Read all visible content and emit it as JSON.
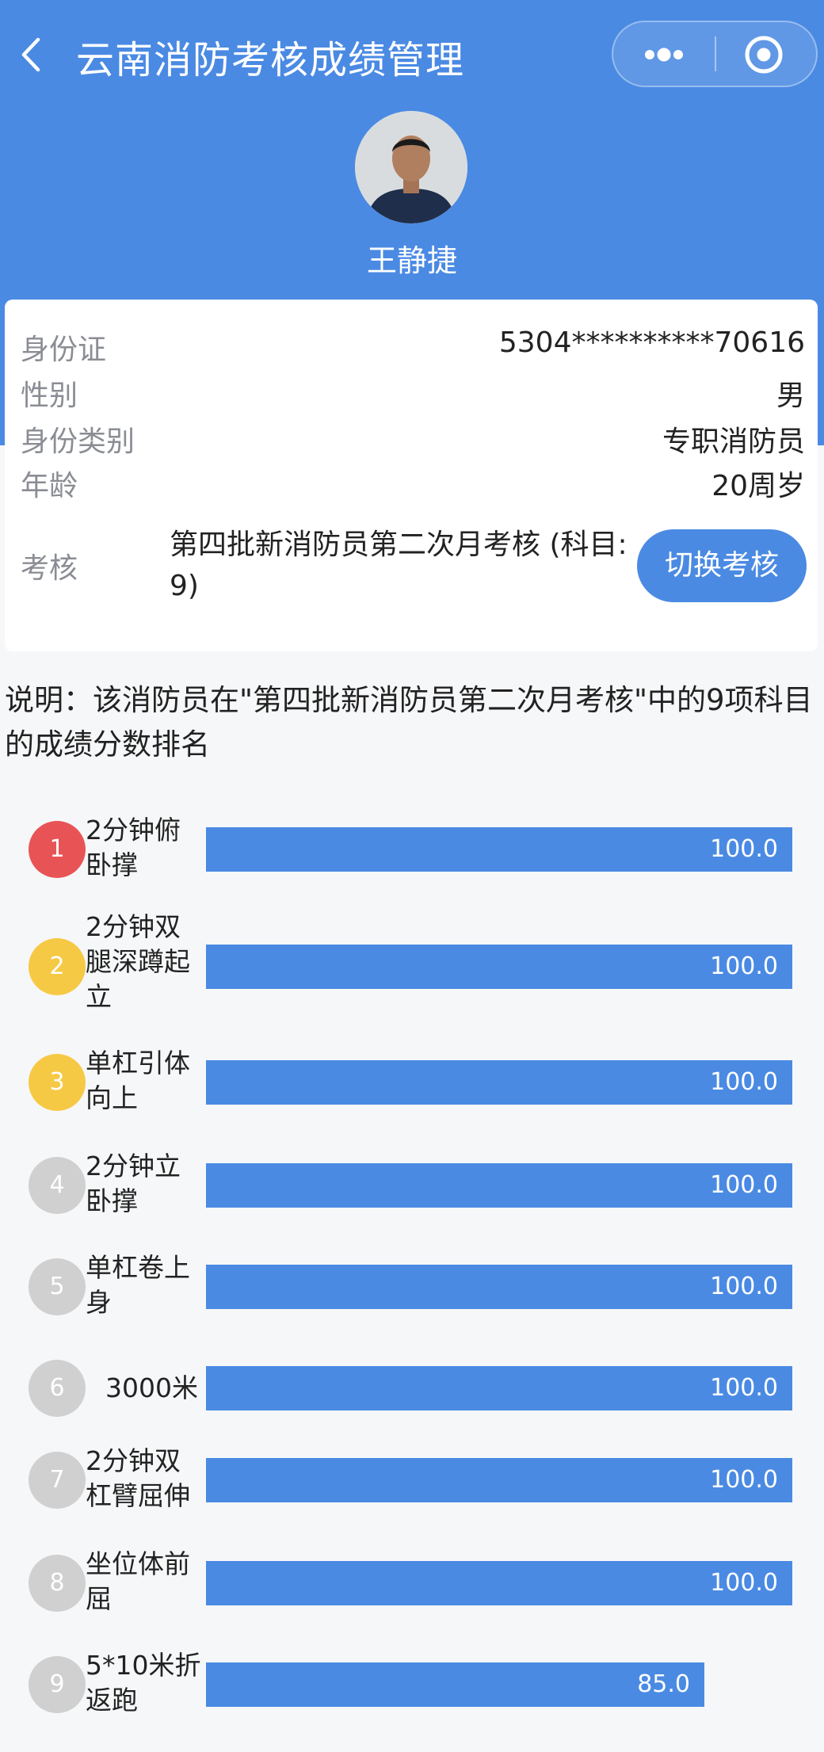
{
  "nav": {
    "title": "云南消防考核成绩管理",
    "back_icon": "chevron-left-icon",
    "more_icon": "more-dots-icon",
    "close_icon": "target-circle-icon"
  },
  "profile": {
    "name": "王静捷"
  },
  "info": [
    {
      "label": "身份证",
      "value": "5304**********70616"
    },
    {
      "label": "性别",
      "value": "男"
    },
    {
      "label": "身份类别",
      "value": "专职消防员"
    },
    {
      "label": "年龄",
      "value": "20周岁"
    }
  ],
  "exam": {
    "label": "考核",
    "value": "第四批新消防员第二次月考核 (科目: 9)",
    "switch_label": "切换考核"
  },
  "description": "说明：该消防员在\"第四批新消防员第二次月考核\"中的9项科目的成绩分数排名",
  "colors": {
    "primary": "#4a8ae3",
    "rank1": "#e85456",
    "rank2_3": "#f6c945",
    "rank_other": "#d0d0d0"
  },
  "rankings": [
    {
      "rank": "1",
      "subject": "2分钟俯卧撑",
      "score": "100.0",
      "percent": 100
    },
    {
      "rank": "2",
      "subject": "2分钟双腿深蹲起立",
      "score": "100.0",
      "percent": 100
    },
    {
      "rank": "3",
      "subject": "单杠引体向上",
      "score": "100.0",
      "percent": 100
    },
    {
      "rank": "4",
      "subject": "2分钟立卧撑",
      "score": "100.0",
      "percent": 100
    },
    {
      "rank": "5",
      "subject": "单杠卷上身",
      "score": "100.0",
      "percent": 100
    },
    {
      "rank": "6",
      "subject": "3000米",
      "score": "100.0",
      "percent": 100
    },
    {
      "rank": "7",
      "subject": "2分钟双杠臂屈伸",
      "score": "100.0",
      "percent": 100
    },
    {
      "rank": "8",
      "subject": "坐位体前屈",
      "score": "100.0",
      "percent": 100
    },
    {
      "rank": "9",
      "subject": "5*10米折返跑",
      "score": "85.0",
      "percent": 85
    }
  ]
}
